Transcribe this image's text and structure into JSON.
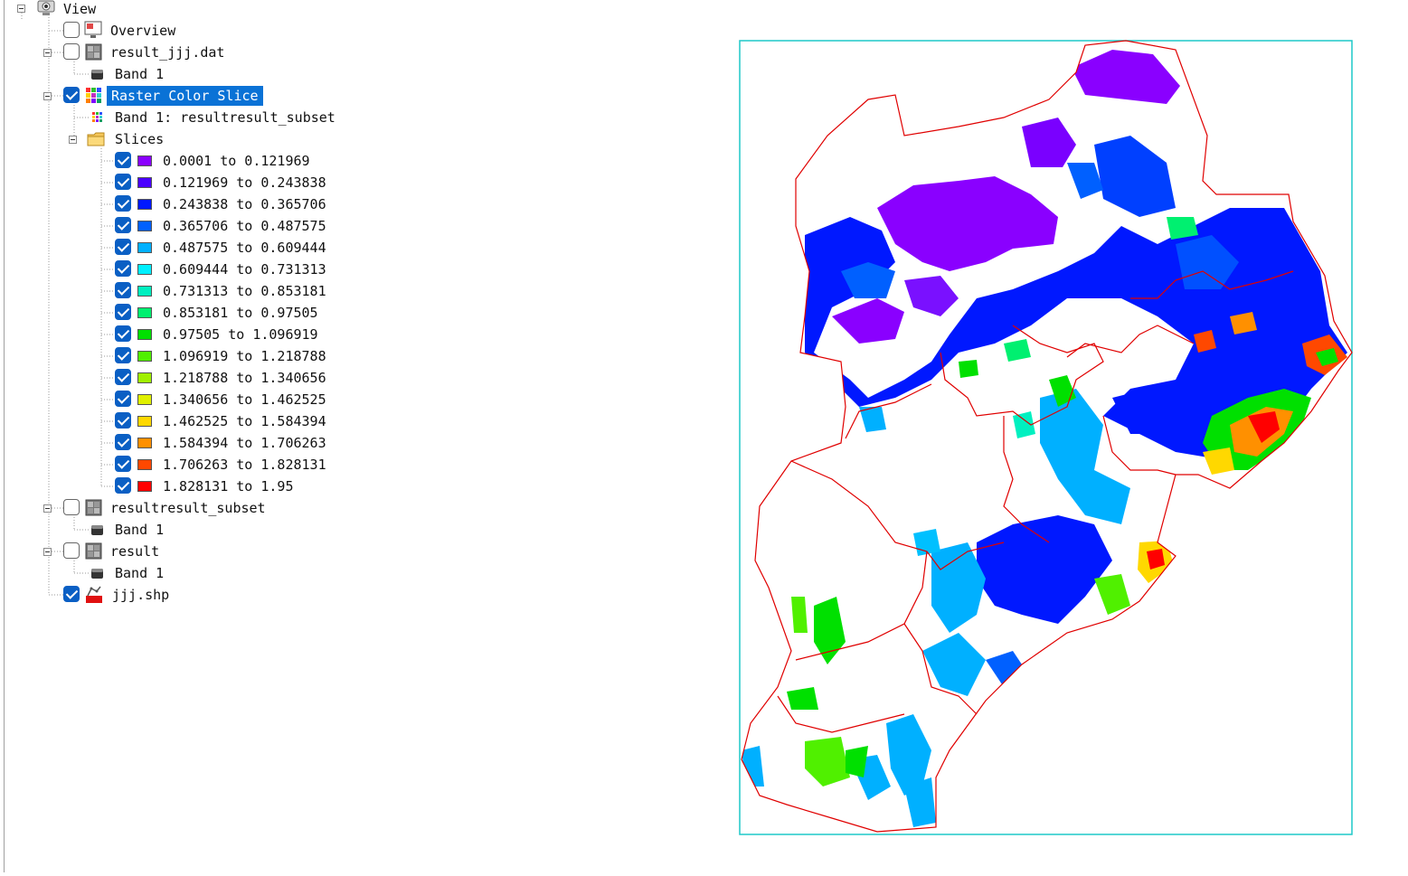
{
  "tree": {
    "root_label": "View",
    "overview_label": "Overview",
    "result_jjj": {
      "label": "result_jjj.dat",
      "band": "Band 1"
    },
    "color_slice": {
      "label": "Raster Color Slice",
      "band": "Band 1: resultresult_subset",
      "slices_label": "Slices"
    },
    "slices": [
      {
        "label": "0.0001  to  0.121969",
        "color": "#8a00ff"
      },
      {
        "label": "0.121969  to  0.243838",
        "color": "#4a00ff"
      },
      {
        "label": "0.243838  to  0.365706",
        "color": "#0018ff"
      },
      {
        "label": "0.365706  to  0.487575",
        "color": "#0060ff"
      },
      {
        "label": "0.487575  to  0.609444",
        "color": "#00b0ff"
      },
      {
        "label": "0.609444  to  0.731313",
        "color": "#00f0ff"
      },
      {
        "label": "0.731313  to  0.853181",
        "color": "#00f0c0"
      },
      {
        "label": "0.853181  to  0.97505",
        "color": "#00f070"
      },
      {
        "label": "0.97505  to  1.096919",
        "color": "#00e000"
      },
      {
        "label": "1.096919  to  1.218788",
        "color": "#50f000"
      },
      {
        "label": "1.218788  to  1.340656",
        "color": "#a0f000"
      },
      {
        "label": "1.340656  to  1.462525",
        "color": "#e0f000"
      },
      {
        "label": "1.462525  to  1.584394",
        "color": "#ffd800"
      },
      {
        "label": "1.584394  to  1.706263",
        "color": "#ff9000"
      },
      {
        "label": "1.706263  to  1.828131",
        "color": "#ff4800"
      },
      {
        "label": "1.828131  to  1.95",
        "color": "#ff0000"
      }
    ],
    "resultresult_subset": {
      "label": "resultresult_subset",
      "band": "Band 1"
    },
    "result": {
      "label": "result",
      "band": "Band 1"
    },
    "shapefile_label": "jjj.shp"
  },
  "map": {
    "frame_color": "#1ec8c8",
    "boundary_color": "#e00000"
  }
}
